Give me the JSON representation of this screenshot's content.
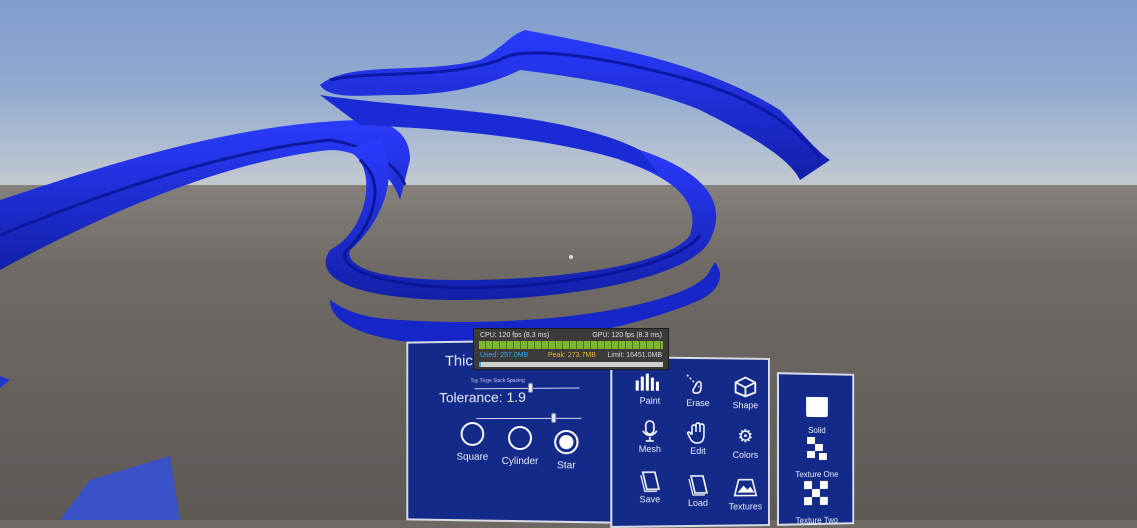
{
  "profiler": {
    "cpu": "CPU: 120 fps (8.3 ms)",
    "gpu": "GPU: 120 fps (8.3 ms)",
    "used": "Used: 257.0MB",
    "peak": "Peak: 273.7MB",
    "limit": "Limit: 16451.0MB",
    "colors": {
      "cpu_bar": "#7eb82a",
      "used": "#37a9e8",
      "peak": "#f0b22c"
    }
  },
  "settings_panel": {
    "thickness_label": "Thick",
    "small_slider_label": "Top Tinge Slack Spacing",
    "tolerance_label": "Tolerance: 1.9",
    "tolerance_value": 1.9,
    "shapes": [
      {
        "label": "Square",
        "selected": false
      },
      {
        "label": "Cylinder",
        "selected": false
      },
      {
        "label": "Star",
        "selected": true
      }
    ]
  },
  "tools_panel": {
    "tools": [
      {
        "label": "Paint",
        "icon": "paint-icon"
      },
      {
        "label": "Erase",
        "icon": "erase-icon"
      },
      {
        "label": "Shape",
        "icon": "cube-icon"
      },
      {
        "label": "Mesh",
        "icon": "microphone-icon"
      },
      {
        "label": "Edit",
        "icon": "hand-icon"
      },
      {
        "label": "Colors",
        "icon": "gear-icon"
      },
      {
        "label": "Save",
        "icon": "save-icon"
      },
      {
        "label": "Load",
        "icon": "load-icon"
      },
      {
        "label": "Textures",
        "icon": "texture-icon"
      }
    ]
  },
  "texture_panel": {
    "textures": [
      {
        "label": "Solid",
        "icon": "solid-square-icon"
      },
      {
        "label": "Texture One",
        "icon": "checker-small-icon"
      },
      {
        "label": "Texture Two",
        "icon": "checker-large-icon"
      }
    ]
  },
  "scene": {
    "ribbon_color": "#1b2ee0",
    "panel_color": "#142a88"
  }
}
